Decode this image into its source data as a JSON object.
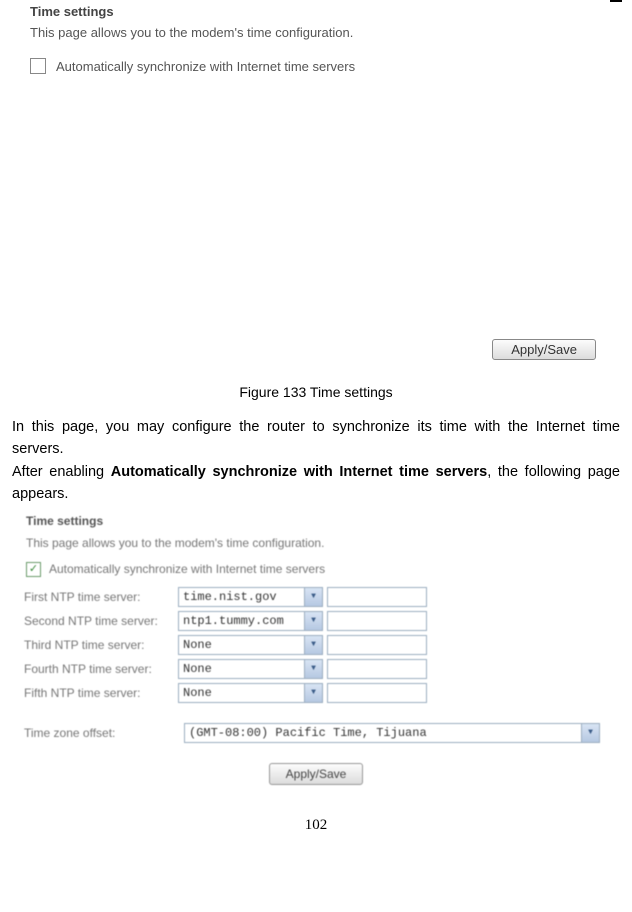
{
  "screenshot1": {
    "title": "Time settings",
    "description": "This page allows you to the modem's time configuration.",
    "checkbox_label": "Automatically synchronize with Internet time servers",
    "apply_label": "Apply/Save"
  },
  "caption": "Figure 133 Time settings",
  "paragraph1_a": "In this page, you may configure the router to synchronize its time with the Internet time servers.",
  "paragraph2_a": "After enabling ",
  "paragraph2_b": "Automatically synchronize with Internet time servers",
  "paragraph2_c": ", the following page appears.",
  "screenshot2": {
    "title": "Time settings",
    "description": "This page allows you to the modem's time configuration.",
    "checkbox_label": "Automatically synchronize with Internet time servers",
    "rows": [
      {
        "label": "First NTP time server:",
        "value": "time.nist.gov"
      },
      {
        "label": "Second NTP time server:",
        "value": "ntp1.tummy.com"
      },
      {
        "label": "Third NTP time server:",
        "value": "None"
      },
      {
        "label": "Fourth NTP time server:",
        "value": "None"
      },
      {
        "label": "Fifth NTP time server:",
        "value": "None"
      }
    ],
    "tz_label": "Time zone offset:",
    "tz_value": "(GMT-08:00) Pacific Time, Tijuana",
    "apply_label": "Apply/Save"
  },
  "page_number": "102"
}
